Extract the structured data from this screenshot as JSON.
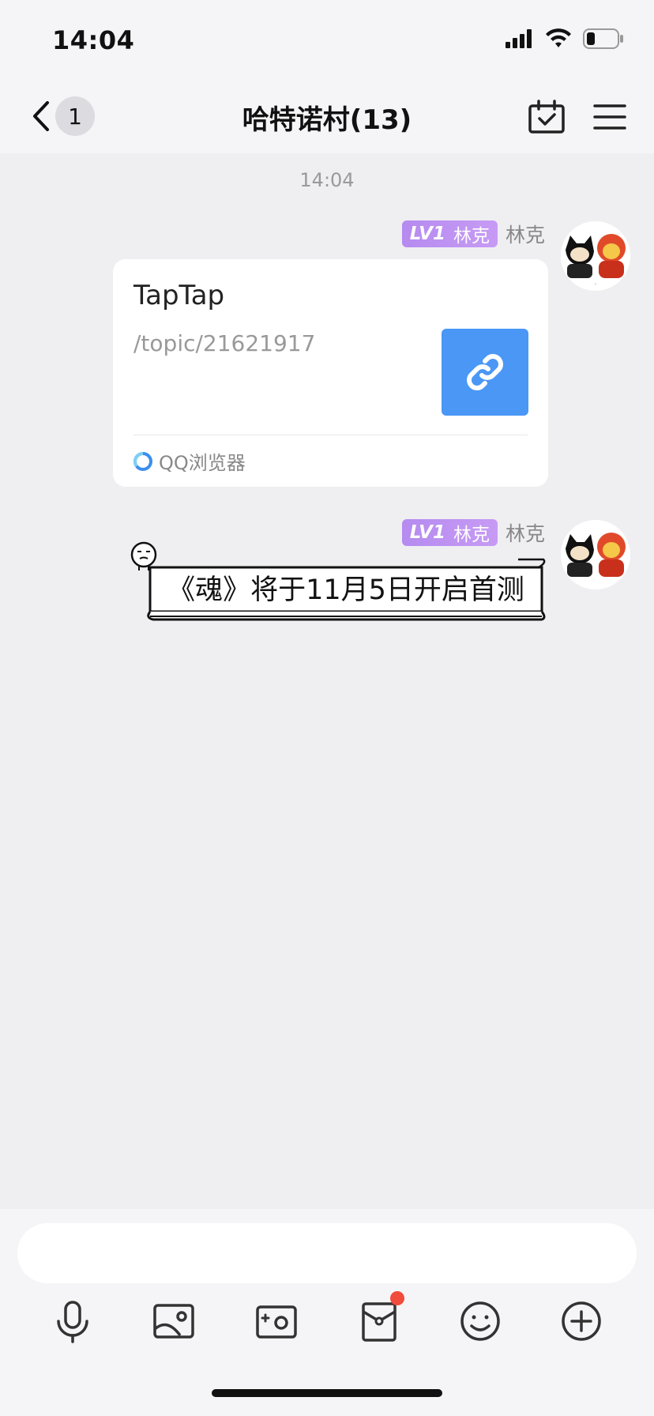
{
  "status": {
    "time": "14:04"
  },
  "nav": {
    "unread_count": "1",
    "title": "哈特诺村(13)"
  },
  "chat": {
    "timestamp": "14:04",
    "messages": [
      {
        "level": "LV1",
        "title_badge": "林克",
        "sender": "林克",
        "card": {
          "title": "TapTap",
          "desc": "/topic/21621917",
          "source": "QQ浏览器"
        }
      },
      {
        "level": "LV1",
        "title_badge": "林克",
        "sender": "林克",
        "banner_text": "《魂》将于11月5日开启首测"
      }
    ]
  },
  "input": {
    "value": "",
    "placeholder": ""
  },
  "colors": {
    "link_blue": "#4a97f6",
    "level_purple": "#b58bf0",
    "notify_red": "#f04b3c"
  }
}
